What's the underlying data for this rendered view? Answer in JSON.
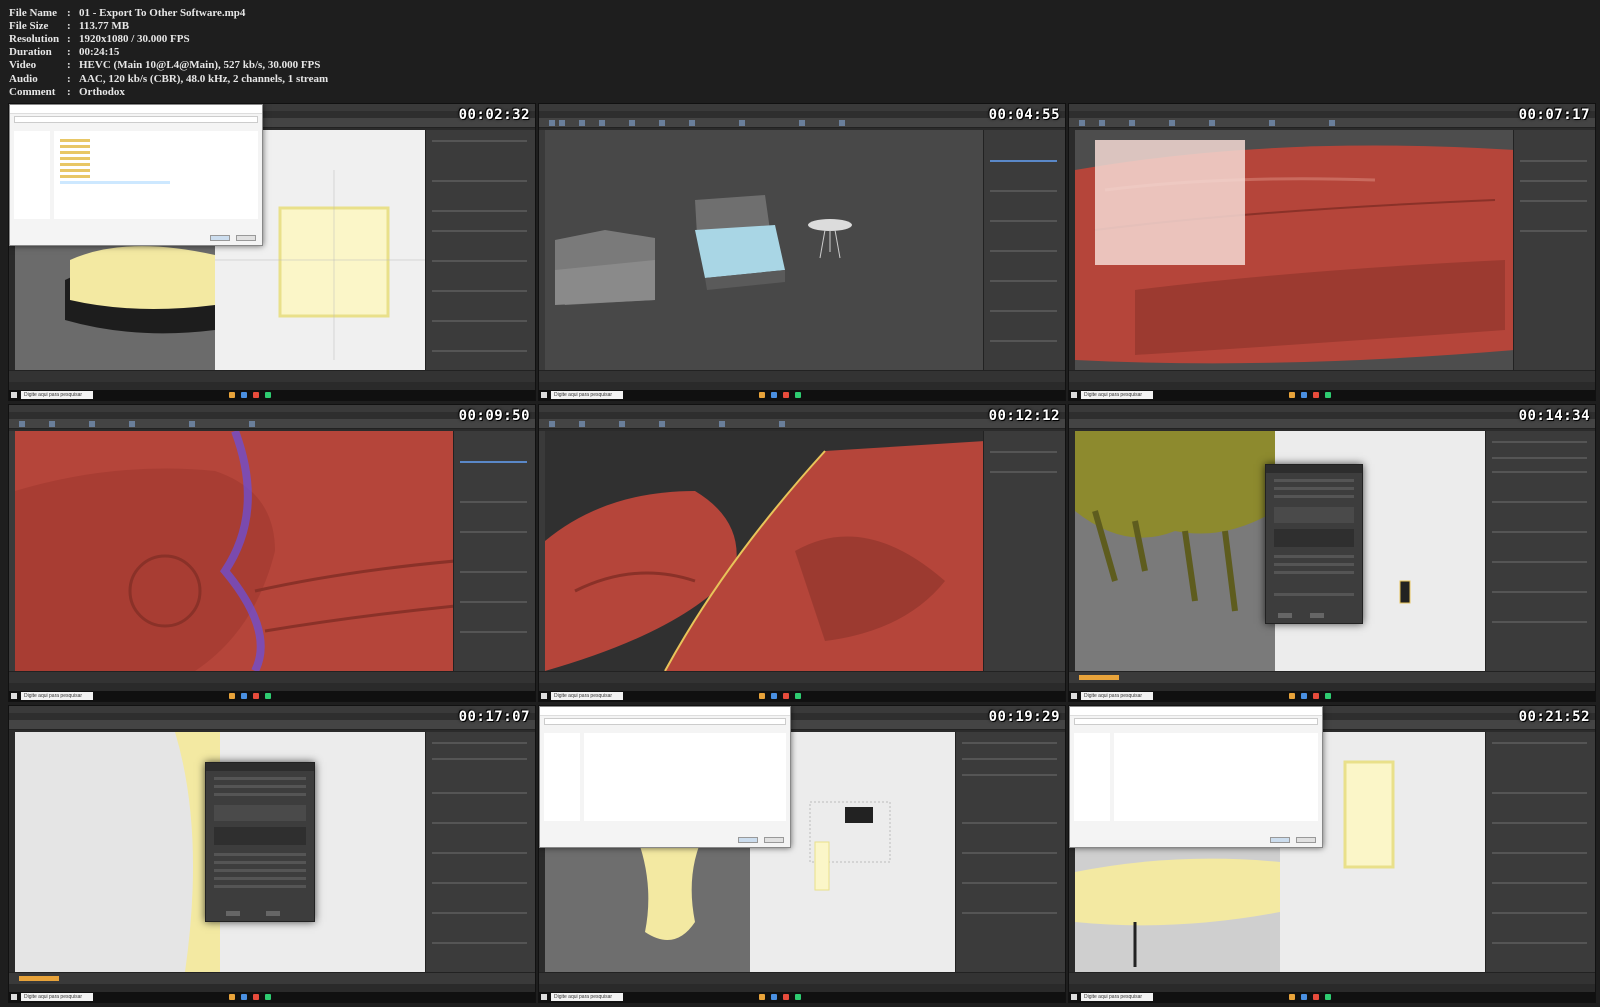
{
  "meta": [
    {
      "key": "File Name",
      "value": "01 - Export To Other Software.mp4"
    },
    {
      "key": "File Size",
      "value": "113.77 MB"
    },
    {
      "key": "Resolution",
      "value": "1920x1080 / 30.000 FPS"
    },
    {
      "key": "Duration",
      "value": "00:24:15"
    },
    {
      "key": "Video",
      "value": "HEVC (Main 10@L4@Main), 527 kb/s, 30.000 FPS"
    },
    {
      "key": "Audio",
      "value": "AAC, 120 kb/s (CBR), 48.0 kHz, 2 channels, 1 stream"
    },
    {
      "key": "Comment",
      "value": "Orthodox"
    }
  ],
  "separator": ":",
  "thumbnails": [
    {
      "timestamp": "00:02:32",
      "scene": "save-dialog-white-cloth"
    },
    {
      "timestamp": "00:04:55",
      "scene": "max-bedroom-objects"
    },
    {
      "timestamp": "00:07:17",
      "scene": "max-red-bed"
    },
    {
      "timestamp": "00:09:50",
      "scene": "max-red-cloth-wireframe"
    },
    {
      "timestamp": "00:12:12",
      "scene": "max-red-cloth-closeup"
    },
    {
      "timestamp": "00:14:34",
      "scene": "md-export-dialog-olive"
    },
    {
      "timestamp": "00:17:07",
      "scene": "md-export-dialog-curtain"
    },
    {
      "timestamp": "00:19:29",
      "scene": "save-dialog-yellow-drape"
    },
    {
      "timestamp": "00:21:52",
      "scene": "save-dialog-tablecloth"
    }
  ],
  "taskbar_search": "Digite aqui para pesquisar",
  "colors": {
    "background": "#1e1e1e",
    "cloth_red": "#b5453a",
    "cloth_yellow": "#f3e9a2",
    "cloth_olive": "#8d8a2e",
    "highlight_orange": "#e8a33a"
  }
}
